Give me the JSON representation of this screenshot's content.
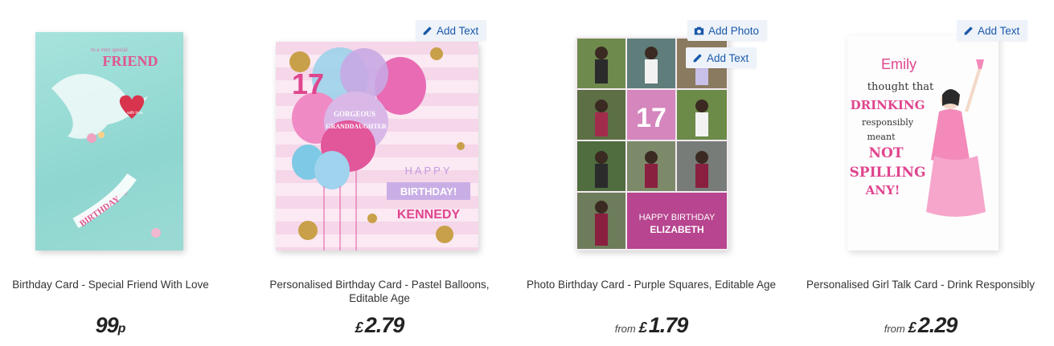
{
  "products": [
    {
      "title": "Birthday Card - Special Friend With Love",
      "from_label": "",
      "currency": "",
      "price": "99",
      "pence_suffix": "p",
      "badges": [],
      "card_text": {
        "top": "to a very special",
        "main": "FRIEND",
        "heart": "with love",
        "bottom": "on your",
        "banner": "BIRTHDAY"
      }
    },
    {
      "title": "Personalised Birthday Card - Pastel Balloons, Editable Age",
      "from_label": "",
      "currency": "£",
      "price": "2.79",
      "badges": [
        "Add Text"
      ],
      "card_text": {
        "age": "17",
        "balloon": "GORGEOUS",
        "balloon2": "GRANDDAUGHTER",
        "happy": "HAPPY",
        "birthday": "BIRTHDAY!",
        "name": "KENNEDY"
      }
    },
    {
      "title": "Photo Birthday Card - Purple Squares, Editable Age",
      "from_label": "from",
      "currency": "£",
      "price": "1.79",
      "badges": [
        "Add Photo",
        "Add Text"
      ],
      "card_text": {
        "age": "17",
        "greeting": "HAPPY BIRTHDAY",
        "name": "ELIZABETH"
      }
    },
    {
      "title": "Personalised Girl Talk Card - Drink Responsibly",
      "from_label": "from",
      "currency": "£",
      "price": "2.29",
      "badges": [
        "Add Text"
      ],
      "card_text": {
        "name": "Emily",
        "l1": "thought that",
        "l2": "DRINKING",
        "l3": "responsibly",
        "l4": "meant",
        "l5": "NOT",
        "l6": "SPILLING",
        "l7": "ANY!"
      }
    }
  ],
  "colors": {
    "badge_text": "#1a59a8",
    "badge_bg": "#eef3fa",
    "purple": "#b7458f"
  }
}
